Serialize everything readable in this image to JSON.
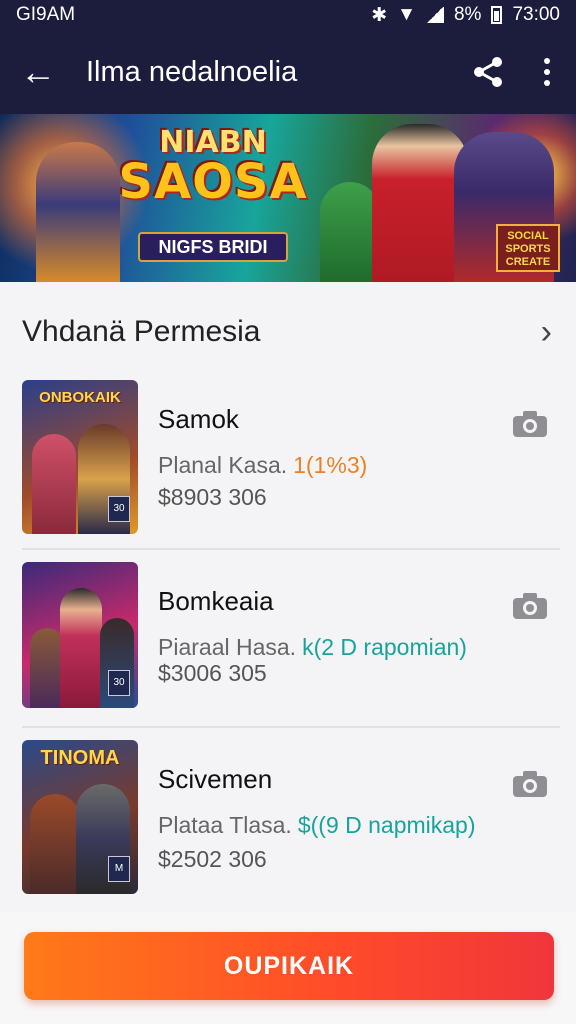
{
  "status_bar": {
    "carrier": "GI9AM",
    "battery": "8%",
    "time": "73:00"
  },
  "app_bar": {
    "title": "Ilma nedalnoelia"
  },
  "banner": {
    "title_line1": "NIABN",
    "title_line2": "SAOSA",
    "subtitle": "NIGFS BRIDI",
    "tag": "SOCIAL SPORTS CREATE"
  },
  "section": {
    "title": "Vhdanä Permesia"
  },
  "items": [
    {
      "thumb_text": "ONBOKAIK",
      "badge": "30",
      "name": "Samok",
      "subtitle": "Planal Kasa.",
      "highlight": "1(1%3)",
      "highlight_color": "#e8822a",
      "price": "$8903  306"
    },
    {
      "thumb_text": "",
      "badge": "30",
      "name": "Bomkeaia",
      "subtitle": "Piaraal Hasa.",
      "highlight": "k(2 D rapomian)",
      "highlight_color": "#1aa39a",
      "price": "$3006  305"
    },
    {
      "thumb_text": "TINOMA",
      "badge": "M",
      "name": "Scivemen",
      "subtitle": "Plataa Tlasa.",
      "highlight": "$((9 D napmikap)",
      "highlight_color": "#1aa39a",
      "price": "$2502  306"
    }
  ],
  "cta": {
    "label": "OUPIKAIK"
  },
  "colors": {
    "appbar": "#1c1d3d",
    "cta_start": "#ff7a18",
    "cta_end": "#f0363a"
  }
}
